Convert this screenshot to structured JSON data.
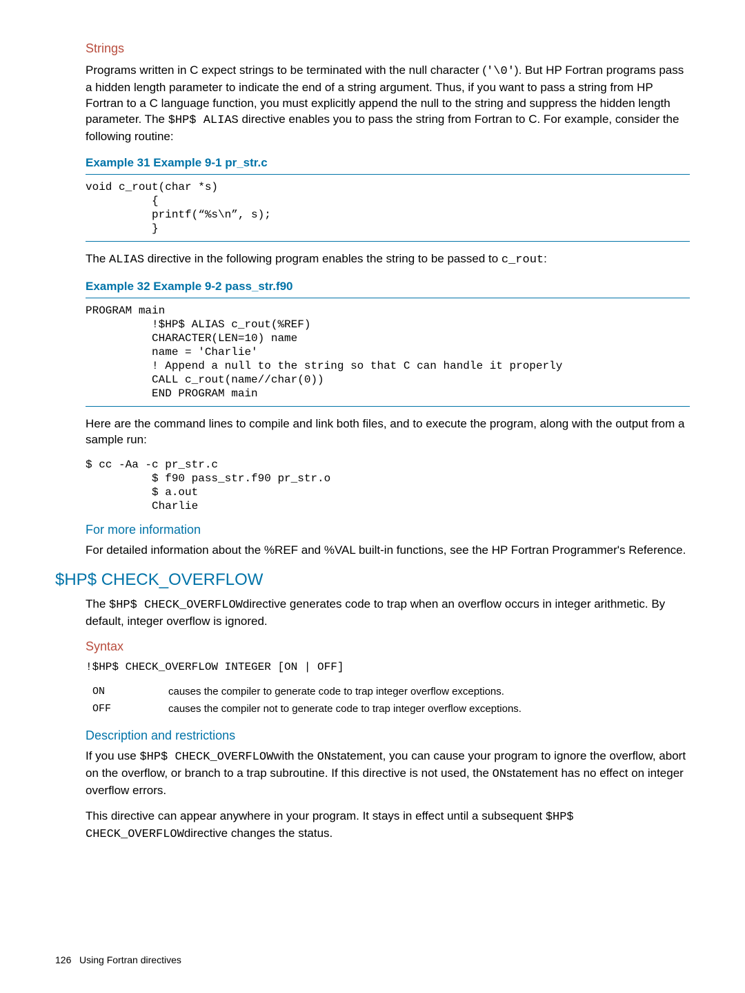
{
  "strings_section": {
    "heading": "Strings",
    "p1_a": "Programs written in C expect strings to be terminated with the null character (",
    "p1_code": "'\\0'",
    "p1_b": "). But HP Fortran programs pass a hidden length parameter to indicate the end of a string argument. Thus, if you want to pass a string from HP Fortran to a C language function, you must explicitly append the null to the string and suppress the hidden length parameter. The ",
    "p1_code2": "$HP$ ALIAS",
    "p1_c": " directive enables you to pass the string from Fortran to C. For example, consider the following routine:"
  },
  "example31": {
    "title": "Example 31 Example 9-1 pr_str.c",
    "code": "void c_rout(char *s)\n          {\n          printf(“%s\\n”, s);\n          }"
  },
  "p_alias_a": "The ",
  "p_alias_code1": "ALIAS",
  "p_alias_b": " directive in the following program enables the string to be passed to ",
  "p_alias_code2": "c_rout",
  "p_alias_c": ":",
  "example32": {
    "title": "Example 32 Example 9-2 pass_str.f90",
    "code": "PROGRAM main\n          !$HP$ ALIAS c_rout(%REF)\n          CHARACTER(LEN=10) name\n          name = 'Charlie'\n          ! Append a null to the string so that C can handle it properly\n          CALL c_rout(name//char(0))\n          END PROGRAM main"
  },
  "p_cmd": "Here are the command lines to compile and link both files, and to execute the program, along with the output from a sample run:",
  "code_cmds": "$ cc -Aa -c pr_str.c\n          $ f90 pass_str.f90 pr_str.o\n          $ a.out\n          Charlie",
  "more_info": {
    "heading": "For more information",
    "p": "For detailed information about the %REF and %VAL built-in functions, see the HP Fortran Programmer's Reference."
  },
  "check_overflow": {
    "heading": "$HP$ CHECK_OVERFLOW",
    "p1_a": "The ",
    "p1_code": "$HP$ CHECK_OVERFLOW",
    "p1_b": "directive generates code to trap when an overflow occurs in integer arithmetic. By default, integer overflow is ignored.",
    "syntax_heading": "Syntax",
    "syntax_line": "!$HP$ CHECK_OVERFLOW INTEGER [ON | OFF]",
    "on_key": "ON",
    "on_desc": "causes the compiler to generate code to trap integer overflow exceptions.",
    "off_key": "OFF",
    "off_desc": "causes the compiler not to generate code to trap integer overflow exceptions.",
    "desc_heading": "Description and restrictions",
    "desc_p1_a": "If you use ",
    "desc_p1_code1": "$HP$ CHECK_OVERFLOW",
    "desc_p1_b": "with the ",
    "desc_p1_code2": "ON",
    "desc_p1_c": "statement, you can cause your program to ignore the overflow, abort on the overflow, or branch to a trap subroutine. If this directive is not used, the ",
    "desc_p1_code3": "ON",
    "desc_p1_d": "statement has no effect on integer overflow errors.",
    "desc_p2_a": "This directive can appear anywhere in your program. It stays in effect until a subsequent ",
    "desc_p2_code1": "$HP$ CHECK_OVERFLOW",
    "desc_p2_b": "directive changes the status."
  },
  "footer": {
    "page": "126",
    "chapter": "Using Fortran directives"
  }
}
